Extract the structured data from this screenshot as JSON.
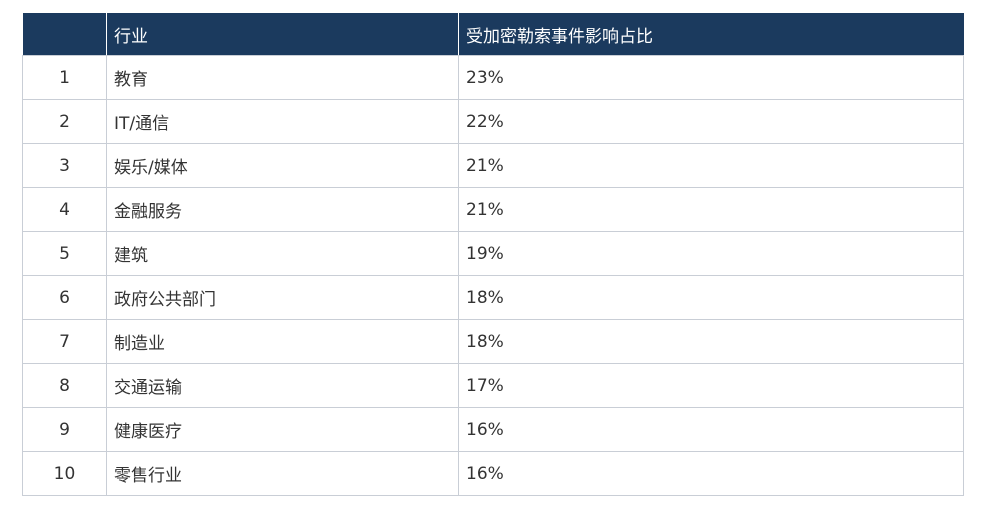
{
  "table": {
    "headers": [
      "",
      "行业",
      "受加密勒索事件影响占比"
    ],
    "rows": [
      {
        "rank": "1",
        "industry": "教育",
        "share": "23%"
      },
      {
        "rank": "2",
        "industry": "IT/通信",
        "share": "22%"
      },
      {
        "rank": "3",
        "industry": "娱乐/媒体",
        "share": "21%"
      },
      {
        "rank": "4",
        "industry": "金融服务",
        "share": "21%"
      },
      {
        "rank": "5",
        "industry": "建筑",
        "share": "19%"
      },
      {
        "rank": "6",
        "industry": "政府公共部门",
        "share": "18%"
      },
      {
        "rank": "7",
        "industry": "制造业",
        "share": "18%"
      },
      {
        "rank": "8",
        "industry": "交通运输",
        "share": "17%"
      },
      {
        "rank": "9",
        "industry": "健康医疗",
        "share": "16%"
      },
      {
        "rank": "10",
        "industry": "零售行业",
        "share": "16%"
      }
    ]
  },
  "colors": {
    "header_bg": "#1b3a5e",
    "header_text": "#ffffff",
    "border": "#c9ced6",
    "text": "#333333"
  }
}
